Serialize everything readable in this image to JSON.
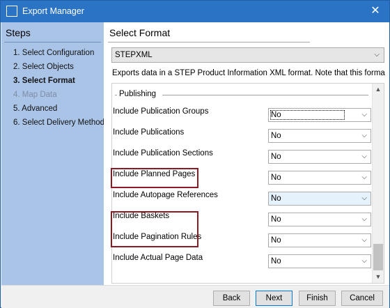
{
  "window": {
    "title": "Export Manager",
    "close_glyph": "✕"
  },
  "sidebar": {
    "title": "Steps",
    "items": [
      {
        "label": "1. Select Configuration",
        "state": "normal"
      },
      {
        "label": "2. Select Objects",
        "state": "normal"
      },
      {
        "label": "3. Select Format",
        "state": "active"
      },
      {
        "label": "4. Map Data",
        "state": "disabled"
      },
      {
        "label": "5. Advanced",
        "state": "normal"
      },
      {
        "label": "6. Select Delivery Method",
        "state": "normal"
      }
    ]
  },
  "main": {
    "title": "Select Format",
    "format": {
      "value": "STEPXML"
    },
    "description": "Exports data in a STEP Product Information XML format. Note that this format i...",
    "group": "Publishing",
    "options": [
      {
        "label": "Include Publication Groups",
        "value": "No"
      },
      {
        "label": "Include Publications",
        "value": "No"
      },
      {
        "label": "Include Publication Sections",
        "value": "No"
      },
      {
        "label": "Include Planned Pages",
        "value": "No"
      },
      {
        "label": "Include Autopage References",
        "value": "No"
      },
      {
        "label": "Include Baskets",
        "value": "No"
      },
      {
        "label": "Include Pagination Rules",
        "value": "No"
      },
      {
        "label": "Include Actual Page Data",
        "value": "No"
      }
    ]
  },
  "footer": {
    "back": "Back",
    "next": "Next",
    "finish": "Finish",
    "cancel": "Cancel"
  },
  "colors": {
    "titlebar": "#2b73c4",
    "sidebar": "#aac4e8",
    "highlight_box": "#8b1a24"
  }
}
